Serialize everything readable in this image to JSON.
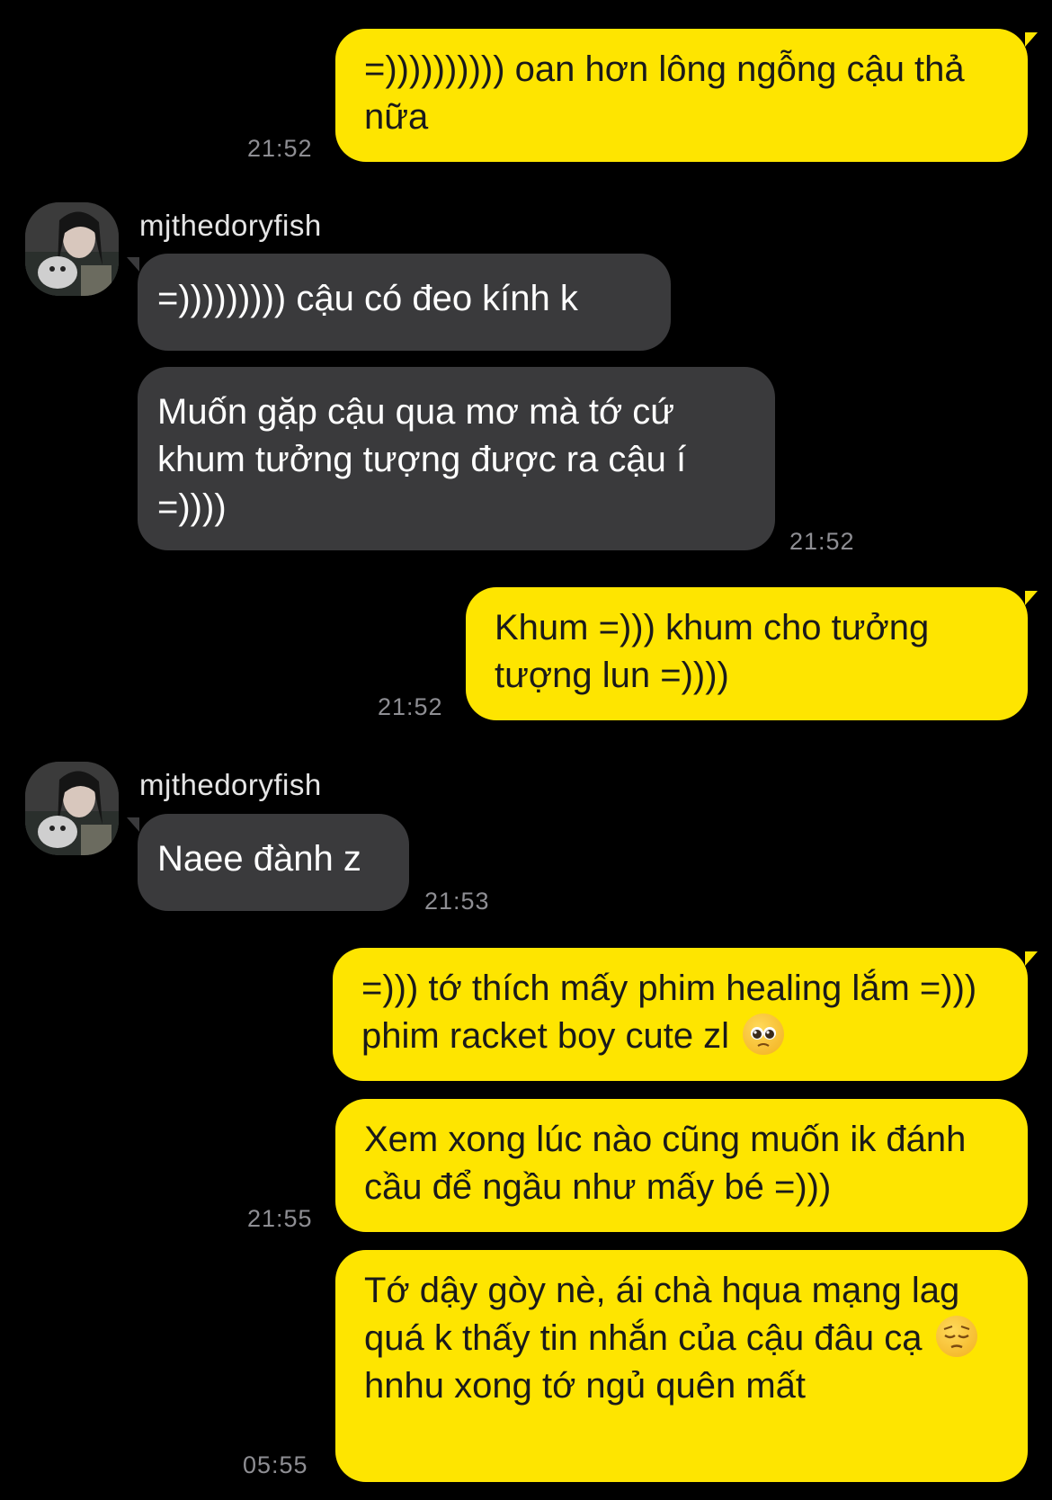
{
  "chat": {
    "messages": [
      {
        "text": "=)))))))))) oan hơn lông ngỗng cậu thả nữa",
        "time": "21:52"
      },
      {
        "text": "=))))))))) cậu có đeo kính k"
      },
      {
        "text": "Muốn gặp cậu qua mơ mà tớ cứ khum tưởng tượng được ra cậu í =))))",
        "time": "21:52"
      },
      {
        "text": "Khum =))) khum cho tưởng tượng lun =))))",
        "time": "21:52"
      },
      {
        "text": "Naee đành z",
        "time": "21:53"
      },
      {
        "text_a": "=))) tớ thích mấy phim healing lắm =))) phim racket boy cute zl"
      },
      {
        "text": "Xem xong lúc nào cũng muốn ik đánh cầu để ngầu như mấy bé =)))",
        "time": "21:55"
      },
      {
        "text_a": "Tớ dậy gòy nè, ái chà hqua mạng lag quá k thấy tin nhắn của cậu đâu cạ",
        "text_b": "hnhu xong tớ ngủ quên mất",
        "time": "05:55"
      }
    ],
    "sender_name": "mjthedoryfish",
    "sender_name_2": "mjthedoryfish",
    "emojis": [
      "pleading-face-emoji",
      "pensive-face-emoji"
    ],
    "colors": {
      "outgoing": "#fee500",
      "incoming": "#3a3a3c",
      "background": "#000000",
      "timestamp": "#8e8e93"
    }
  }
}
